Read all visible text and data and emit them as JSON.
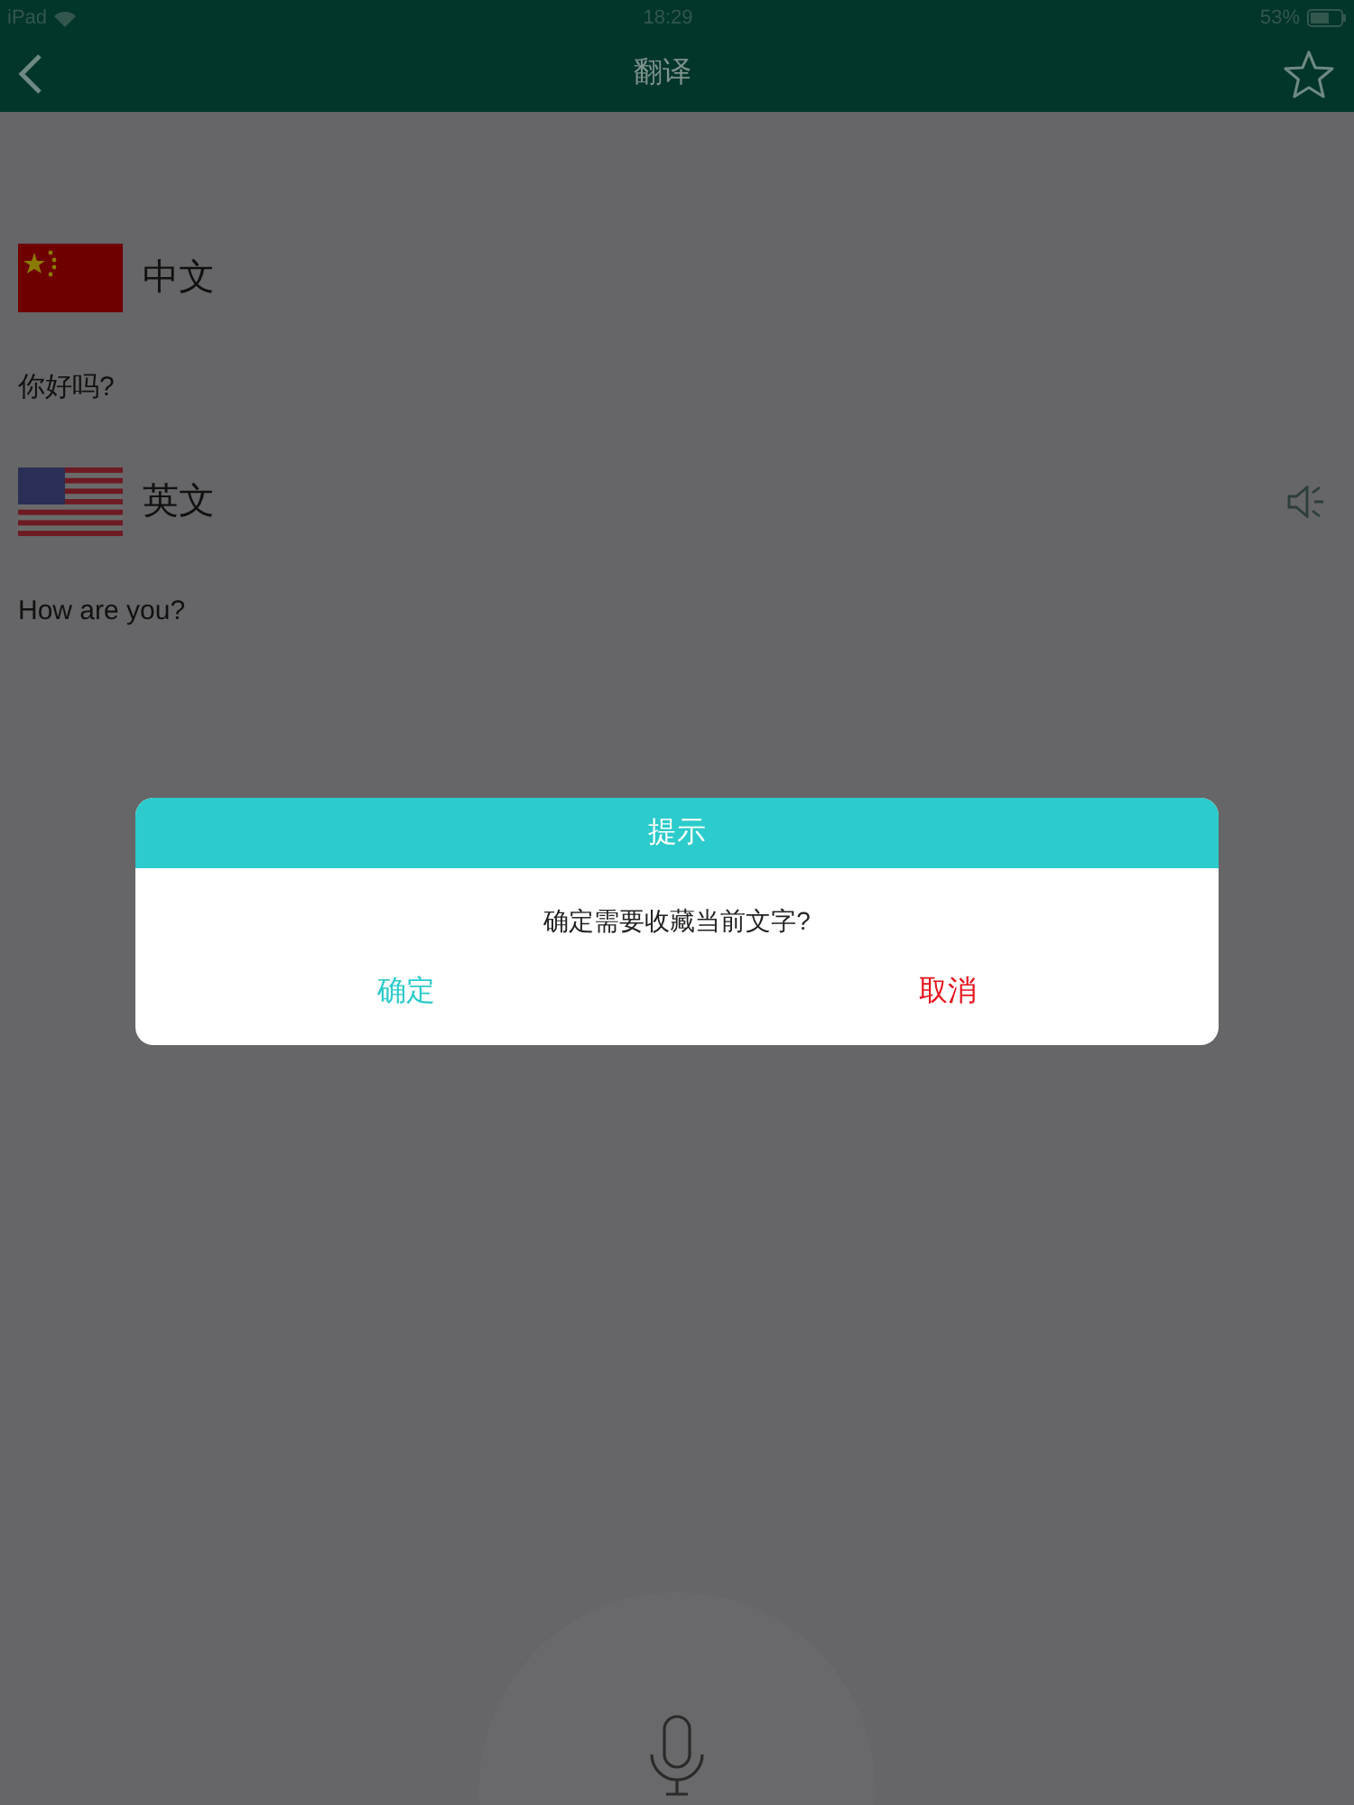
{
  "status_bar": {
    "device": "iPad",
    "time": "18:29",
    "battery": "53%"
  },
  "nav": {
    "title": "翻译"
  },
  "languages": [
    {
      "kind": "cn",
      "name": "中文",
      "text": "你好吗?",
      "speaker": false
    },
    {
      "kind": "us",
      "name": "英文",
      "text": "How are you?",
      "speaker": true
    }
  ],
  "dialog": {
    "title": "提示",
    "message": "确定需要收藏当前文字?",
    "buttons": [
      {
        "label": "确定",
        "kind": "confirm"
      },
      {
        "label": "取消",
        "kind": "cancel"
      }
    ]
  }
}
